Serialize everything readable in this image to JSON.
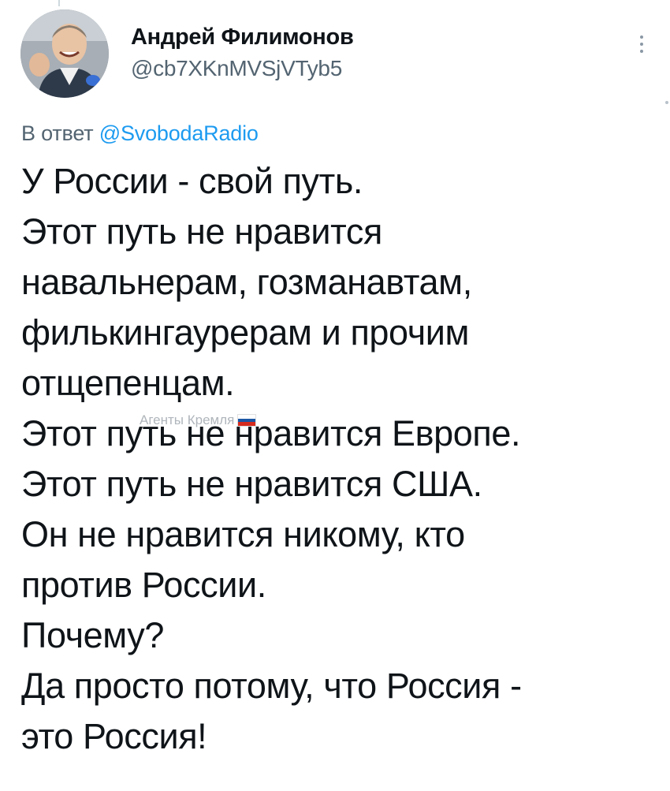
{
  "author": {
    "display_name": "Андрей Филимонов",
    "handle": "@cb7XKnMVSjVTyb5"
  },
  "reply": {
    "prefix": "В ответ",
    "mention": "@SvobodaRadio"
  },
  "tweet": {
    "lines": [
      "У России - свой путь.",
      "Этот путь не нравится",
      "навальнерам, гозманавтам,",
      "филькингаурерам и прочим",
      "отщепенцам.",
      "Этот путь не нравится Европе.",
      "Этот путь не нравится США.",
      "Он не нравится никому, кто",
      "против России.",
      "Почему?",
      "Да просто потому, что Россия -",
      "это Россия!"
    ]
  },
  "watermark": {
    "text": "Агенты Кремля",
    "flag_colors": [
      "#ffffff",
      "#1c57a5",
      "#d52b1e"
    ]
  },
  "icons": {
    "more": "more-vertical-icon",
    "avatar": "profile-photo"
  },
  "colors": {
    "text": "#0f1419",
    "secondary": "#536471",
    "link": "#1d9bf0"
  }
}
